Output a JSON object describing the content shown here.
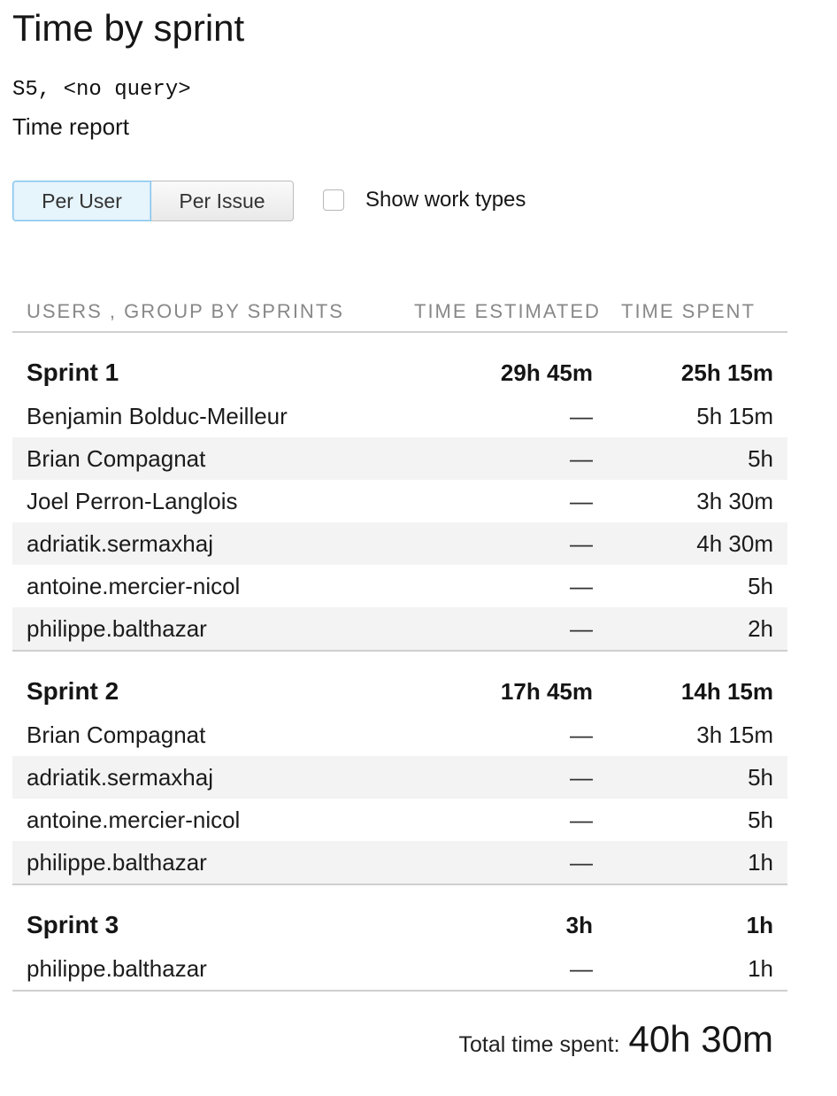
{
  "page": {
    "title": "Time by sprint",
    "query": "S5, <no query>",
    "report_name": "Time report"
  },
  "controls": {
    "per_user_label": "Per User",
    "per_issue_label": "Per Issue",
    "active_mode": "Per User",
    "show_work_types_label": "Show work types",
    "show_work_types_checked": false
  },
  "table": {
    "headers": {
      "name": "USERS , GROUP BY SPRINTS",
      "estimated": "TIME ESTIMATED",
      "spent": "TIME SPENT"
    },
    "sprints": [
      {
        "name": "Sprint 1",
        "estimated": "29h 45m",
        "spent": "25h 15m",
        "users": [
          {
            "name": "Benjamin Bolduc-Meilleur",
            "estimated": "—",
            "spent": "5h 15m"
          },
          {
            "name": "Brian Compagnat",
            "estimated": "—",
            "spent": "5h"
          },
          {
            "name": "Joel Perron-Langlois",
            "estimated": "—",
            "spent": "3h 30m"
          },
          {
            "name": "adriatik.sermaxhaj",
            "estimated": "—",
            "spent": "4h 30m"
          },
          {
            "name": "antoine.mercier-nicol",
            "estimated": "—",
            "spent": "5h"
          },
          {
            "name": "philippe.balthazar",
            "estimated": "—",
            "spent": "2h"
          }
        ]
      },
      {
        "name": "Sprint 2",
        "estimated": "17h 45m",
        "spent": "14h 15m",
        "users": [
          {
            "name": "Brian Compagnat",
            "estimated": "—",
            "spent": "3h 15m"
          },
          {
            "name": "adriatik.sermaxhaj",
            "estimated": "—",
            "spent": "5h"
          },
          {
            "name": "antoine.mercier-nicol",
            "estimated": "—",
            "spent": "5h"
          },
          {
            "name": "philippe.balthazar",
            "estimated": "—",
            "spent": "1h"
          }
        ]
      },
      {
        "name": "Sprint 3",
        "estimated": "3h",
        "spent": "1h",
        "users": [
          {
            "name": "philippe.balthazar",
            "estimated": "—",
            "spent": "1h"
          }
        ]
      }
    ]
  },
  "total": {
    "label": "Total time spent:",
    "value": "40h 30m"
  },
  "colors": {
    "active_toggle_bg": "#e6f4fc",
    "active_toggle_border": "#7fc3ea",
    "zebra_row": "#f3f3f3",
    "header_text": "#888888",
    "divider": "#cfcfcf"
  }
}
